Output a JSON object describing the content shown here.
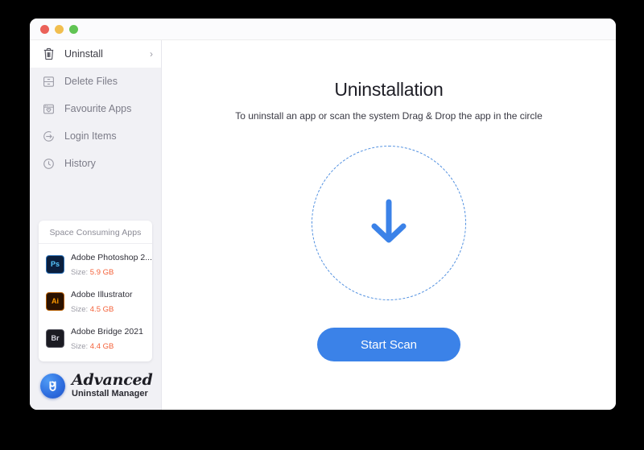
{
  "window": {
    "traffic_lights": [
      {
        "name": "close",
        "color": "#eb6159"
      },
      {
        "name": "minimize",
        "color": "#f1be4f"
      },
      {
        "name": "zoom",
        "color": "#61c454"
      }
    ]
  },
  "sidebar": {
    "items": [
      {
        "label": "Uninstall",
        "icon": "trash-icon",
        "active": true,
        "chevron": "›"
      },
      {
        "label": "Delete Files",
        "icon": "drawer-icon",
        "active": false,
        "chevron": ""
      },
      {
        "label": "Favourite Apps",
        "icon": "heart-window-icon",
        "active": false,
        "chevron": ""
      },
      {
        "label": "Login Items",
        "icon": "login-arrow-icon",
        "active": false,
        "chevron": ""
      },
      {
        "label": "History",
        "icon": "clock-icon",
        "active": false,
        "chevron": ""
      }
    ],
    "apps_card": {
      "title": "Space Consuming Apps",
      "size_label": "Size:",
      "apps": [
        {
          "abbr": "Ps",
          "name": "Adobe Photoshop 2...",
          "size": "5.9 GB",
          "icon_class": "ps"
        },
        {
          "abbr": "Ai",
          "name": "Adobe Illustrator",
          "size": "4.5 GB",
          "icon_class": "ai"
        },
        {
          "abbr": "Br",
          "name": "Adobe Bridge 2021",
          "size": "4.4 GB",
          "icon_class": "br"
        }
      ]
    },
    "brand": {
      "line1": "Advanced",
      "line2": "Uninstall Manager",
      "badge_icon": "uninstall-logo-icon"
    }
  },
  "main": {
    "title": "Uninstallation",
    "subtitle": "To uninstall an app or scan the system Drag & Drop the app in the circle",
    "dropzone": {
      "icon": "down-arrow-icon",
      "border_color": "#5190e0"
    },
    "scan_button": {
      "label": "Start Scan",
      "color": "#3b82e8"
    }
  },
  "colors": {
    "accent": "#3b82e8",
    "sidebar_bg": "#f1f1f5",
    "size_text": "#f4623a"
  }
}
